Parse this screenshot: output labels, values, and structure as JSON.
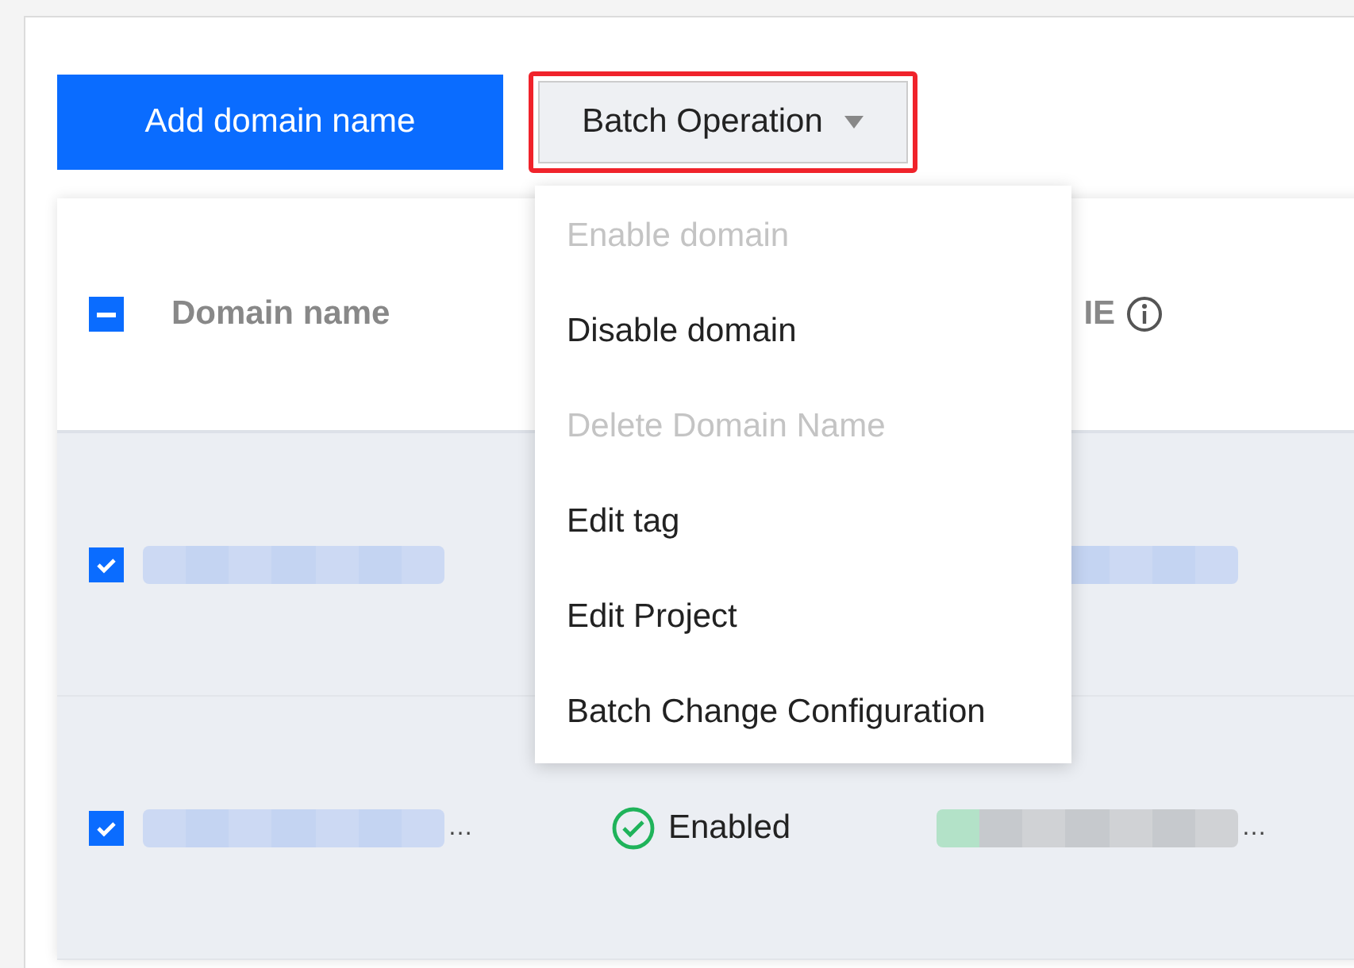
{
  "toolbar": {
    "add_button": "Add domain name",
    "batch_button": {
      "label": "Batch Operation",
      "highlighted": true,
      "expanded": true
    }
  },
  "batch_menu": [
    {
      "label": "Enable domain",
      "disabled": true
    },
    {
      "label": "Disable domain",
      "disabled": false
    },
    {
      "label": "Delete Domain Name",
      "disabled": true
    },
    {
      "label": "Edit tag",
      "disabled": false
    },
    {
      "label": "Edit Project",
      "disabled": false
    },
    {
      "label": "Batch Change Configuration",
      "disabled": false
    }
  ],
  "table": {
    "header_checkbox": {
      "indeterminate": true
    },
    "columns": [
      {
        "label": "Domain name"
      },
      {
        "label": "IE",
        "info": true
      }
    ],
    "rows": [
      {
        "checked": true
      },
      {
        "checked": true,
        "domain_tail": "…",
        "status": "Enabled",
        "cname_tail": "…"
      }
    ]
  }
}
